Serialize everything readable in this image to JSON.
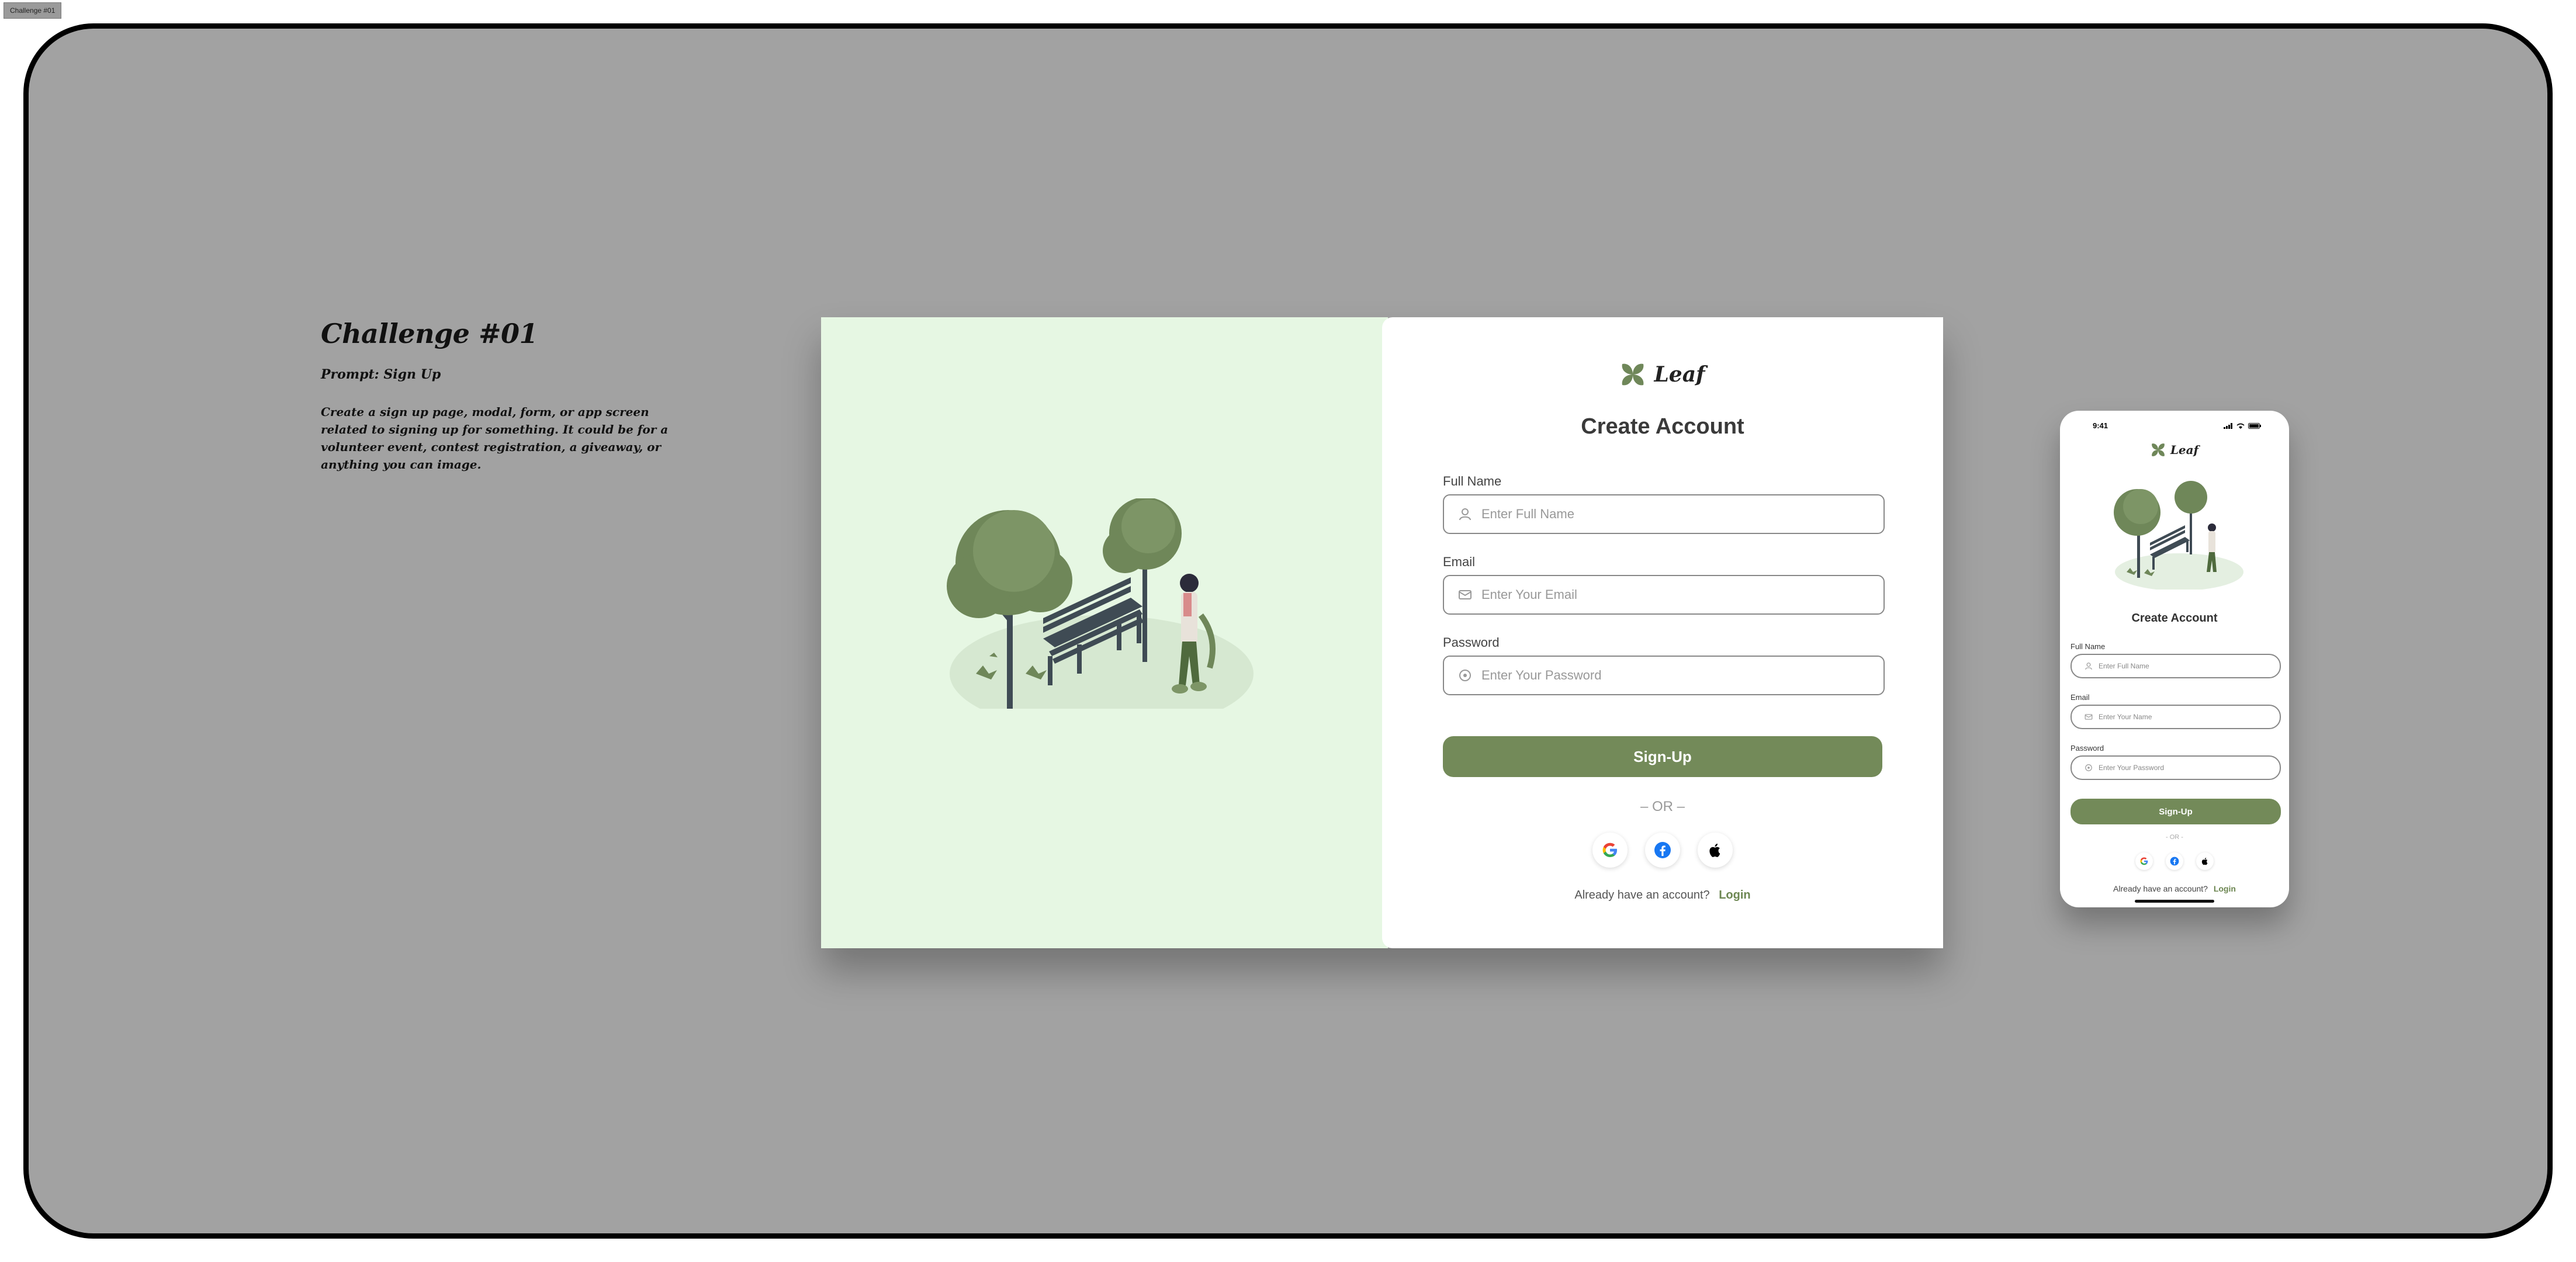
{
  "frame_label": "Challenge #01",
  "brief": {
    "title": "Challenge #01",
    "prompt": "Prompt: Sign Up",
    "description": "Create a sign up page, modal, form, or app screen related to signing up for something. It could be for a volunteer event, contest registration, a giveaway, or anything you can image."
  },
  "brand": {
    "name": "Leaf",
    "accent": "#738a59",
    "illustration_bg": "#e6f7e3"
  },
  "desktop": {
    "title": "Create Account",
    "fields": [
      {
        "label": "Full Name",
        "placeholder": "Enter Full Name",
        "icon": "user-icon"
      },
      {
        "label": "Email",
        "placeholder": "Enter Your Email",
        "icon": "mail-icon"
      },
      {
        "label": "Password",
        "placeholder": "Enter Your Password",
        "icon": "lock-icon"
      }
    ],
    "signup_label": "Sign-Up",
    "or_text": "– OR –",
    "social": [
      "google-icon",
      "facebook-icon",
      "apple-icon"
    ],
    "login_prompt": "Already have an account?",
    "login_link": "Login"
  },
  "mobile": {
    "time": "9:41",
    "title": "Create Account",
    "fields": [
      {
        "label": "Full Name",
        "placeholder": "Enter Full Name",
        "icon": "user-icon"
      },
      {
        "label": "Email",
        "placeholder": "Enter Your Name",
        "icon": "mail-icon"
      },
      {
        "label": "Password",
        "placeholder": "Enter Your Password",
        "icon": "lock-icon"
      }
    ],
    "signup_label": "Sign-Up",
    "or_text": "- OR -",
    "login_prompt": "Already have an account?",
    "login_link": "Login"
  }
}
